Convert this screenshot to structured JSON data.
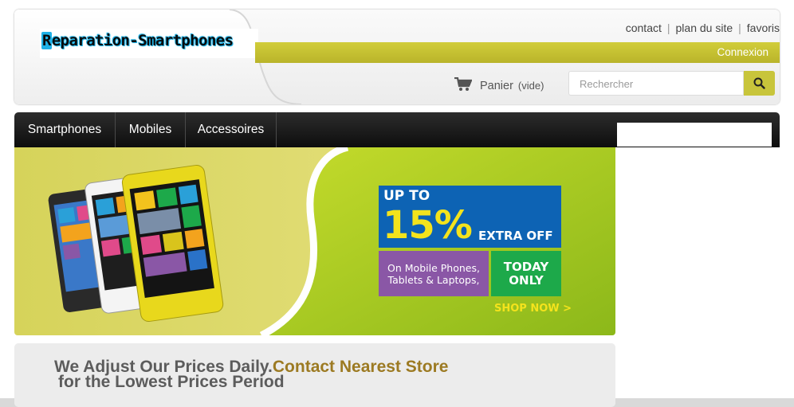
{
  "header": {
    "logo_text": "Reparation-Smartphones",
    "logo_first": "R",
    "logo_rest": "eparation-Smartphones",
    "top_links": [
      "contact",
      "plan du site",
      "favoris"
    ],
    "login_label": "Connexion",
    "cart_label": "Panier",
    "cart_state": "(vide)",
    "search_placeholder": "Rechercher",
    "accent_color": "#c8c53b"
  },
  "nav": {
    "items": [
      {
        "label": "Smartphones"
      },
      {
        "label": "Mobiles"
      },
      {
        "label": "Accessoires"
      }
    ]
  },
  "banner": {
    "up_to": "UP TO",
    "percent": "15%",
    "extra_off": "EXTRA OFF",
    "purple_line1": "On Mobile Phones,",
    "purple_line2": "Tablets & Laptops,",
    "green_line1": "TODAY",
    "green_line2": "ONLY",
    "shop_now": "SHOP NOW >",
    "colors": {
      "blue": "#0d63b4",
      "yellow": "#f4e31c",
      "purple": "#8a57a6",
      "green": "#1da94a"
    }
  },
  "promo": {
    "line1_prefix": "We Adjust Our Prices Daily.",
    "line1_highlight": "Contact Nearest Store",
    "line2": "for the Lowest Prices Period"
  }
}
